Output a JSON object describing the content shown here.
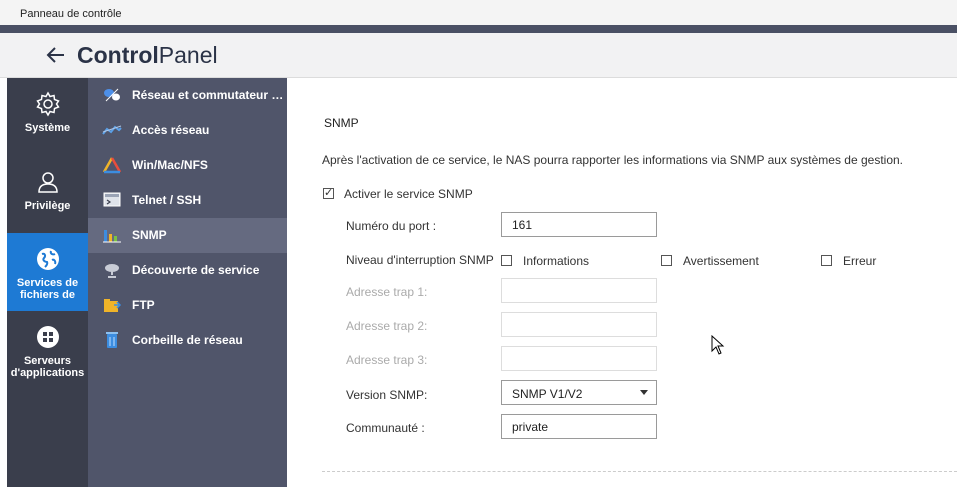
{
  "window": {
    "title": "Panneau de contrôle"
  },
  "header": {
    "title_bold": "Control",
    "title_light": "Panel"
  },
  "rail": [
    {
      "label": "Système",
      "icon": "gear-icon"
    },
    {
      "label": "Privilège",
      "icon": "user-icon"
    },
    {
      "label": "Services de fichiers de",
      "icon": "globe-icon"
    },
    {
      "label": "Serveurs d'applications",
      "icon": "apps-icon"
    }
  ],
  "subnav": [
    {
      "label": "Réseau et commutateur …",
      "icon": "network-switch-icon"
    },
    {
      "label": "Accès réseau",
      "icon": "network-access-icon"
    },
    {
      "label": "Win/Mac/NFS",
      "icon": "win-mac-nfs-icon"
    },
    {
      "label": "Telnet / SSH",
      "icon": "terminal-icon"
    },
    {
      "label": "SNMP",
      "icon": "snmp-chart-icon"
    },
    {
      "label": "Découverte de service",
      "icon": "satellite-dish-icon"
    },
    {
      "label": "FTP",
      "icon": "ftp-folder-icon"
    },
    {
      "label": "Corbeille de réseau",
      "icon": "recycle-bin-icon"
    }
  ],
  "snmp": {
    "title": "SNMP",
    "description": "Après l'activation de ce service, le NAS pourra rapporter les informations via SNMP aux systèmes de gestion.",
    "enable_label": "Activer le service SNMP",
    "enable_checked": true,
    "port_label": "Numéro du port :",
    "port_value": "161",
    "trap_level_label": "Niveau d'interruption SNMP",
    "trap_levels": [
      {
        "label": "Informations",
        "checked": false
      },
      {
        "label": "Avertissement",
        "checked": false
      },
      {
        "label": "Erreur",
        "checked": false
      }
    ],
    "trap1_label": "Adresse trap 1:",
    "trap2_label": "Adresse trap 2:",
    "trap3_label": "Adresse trap 3:",
    "version_label": "Version SNMP:",
    "version_value": "SNMP V1/V2",
    "community_label": "Communauté :",
    "community_value": "private"
  },
  "colors": {
    "accent": "#1e7ad4",
    "rail_bg": "#3a3e4c",
    "subnav_bg": "#50556a"
  }
}
